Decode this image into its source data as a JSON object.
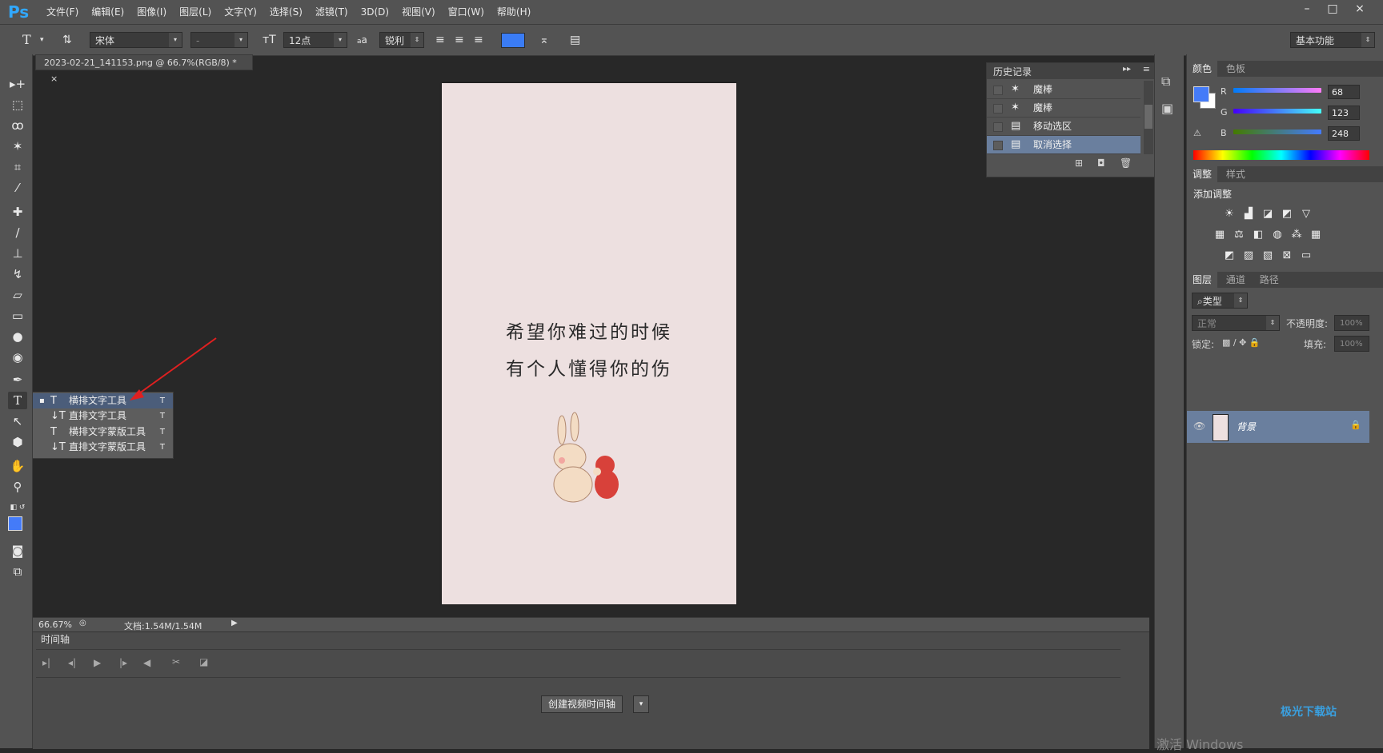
{
  "app": {
    "logo": "Ps"
  },
  "menu": [
    "文件(F)",
    "编辑(E)",
    "图像(I)",
    "图层(L)",
    "文字(Y)",
    "选择(S)",
    "滤镜(T)",
    "3D(D)",
    "视图(V)",
    "窗口(W)",
    "帮助(H)"
  ],
  "window_controls": {
    "minimize": "–",
    "maximize": "□",
    "close": "×"
  },
  "options": {
    "tool_icon": "T",
    "font_family": "宋体",
    "font_style": "-",
    "font_size": "12点",
    "aa_label": "a",
    "aa_mode": "锐利",
    "text_color": "#3a7cf5",
    "workspace": "基本功能"
  },
  "document": {
    "tab_title": "2023-02-21_141153.png @ 66.7%(RGB/8) *",
    "tab_close": "×",
    "line1": "希望你难过的时候",
    "line2": "有个人懂得你的伤",
    "bg_color": "#ede0e0"
  },
  "flyout": [
    {
      "label": "横排文字工具",
      "shortcut": "T",
      "icon": "horizontal-type-icon",
      "glyph": "T",
      "selected": true
    },
    {
      "label": "直排文字工具",
      "shortcut": "T",
      "icon": "vertical-type-icon",
      "glyph": "↓T",
      "selected": false
    },
    {
      "label": "横排文字蒙版工具",
      "shortcut": "T",
      "icon": "horizontal-type-mask-icon",
      "glyph": "T",
      "selected": false
    },
    {
      "label": "直排文字蒙版工具",
      "shortcut": "T",
      "icon": "vertical-type-mask-icon",
      "glyph": "↓T",
      "selected": false
    }
  ],
  "status": {
    "zoom": "66.67%",
    "doc_size": "文档:1.54M/1.54M"
  },
  "timeline": {
    "tab": "时间轴",
    "create_button": "创建视频时间轴"
  },
  "history": {
    "tab": "历史记录",
    "items": [
      {
        "label": "魔棒",
        "icon": "magic-wand-icon",
        "selected": false
      },
      {
        "label": "魔棒",
        "icon": "magic-wand-icon",
        "selected": false
      },
      {
        "label": "移动选区",
        "icon": "document-icon",
        "selected": false
      },
      {
        "label": "取消选择",
        "icon": "document-icon",
        "selected": true
      }
    ]
  },
  "color_panel": {
    "tabs": [
      "颜色",
      "色板"
    ],
    "r_label": "R",
    "g_label": "G",
    "b_label": "B",
    "r": "68",
    "g": "123",
    "b": "248",
    "foreground": "#447bf8"
  },
  "adjust_panel": {
    "tabs": [
      "调整",
      "样式"
    ],
    "heading": "添加调整"
  },
  "layers_panel": {
    "tabs": [
      "图层",
      "通道",
      "路径"
    ],
    "filter": "类型",
    "blend_mode": "正常",
    "opacity_label": "不透明度:",
    "opacity": "100%",
    "lock_label": "锁定:",
    "fill_label": "填充:",
    "fill": "100%",
    "layer_name": "背景"
  },
  "watermark": "极光下载站",
  "activate_text": "激活 Windows"
}
